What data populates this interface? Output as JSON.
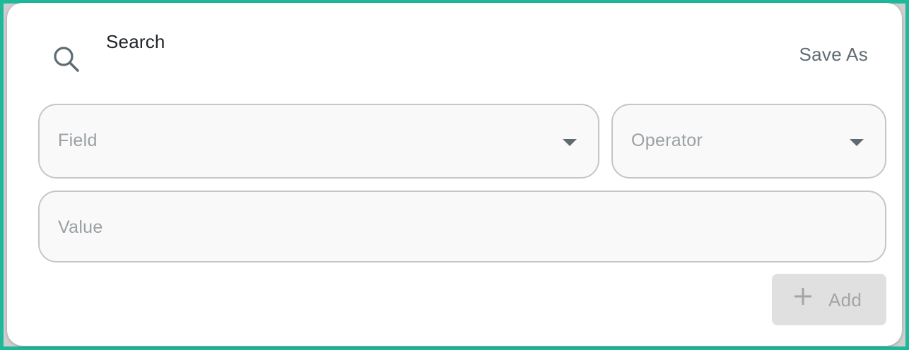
{
  "dialog": {
    "title": "Search",
    "save_as_label": "Save As"
  },
  "filters": {
    "field_placeholder": "Field",
    "operator_placeholder": "Operator",
    "value_placeholder": "Value"
  },
  "actions": {
    "add_label": "Add"
  },
  "icons": {
    "title": "search-icon",
    "field_dropdown": "chevron-down-icon",
    "operator_dropdown": "chevron-down-icon",
    "add": "plus-icon"
  },
  "colors": {
    "accent_border": "#1fb99a",
    "icon": "#5f6b72",
    "placeholder": "#9aa0a4",
    "disabled_button_bg": "#e0e0e0"
  }
}
